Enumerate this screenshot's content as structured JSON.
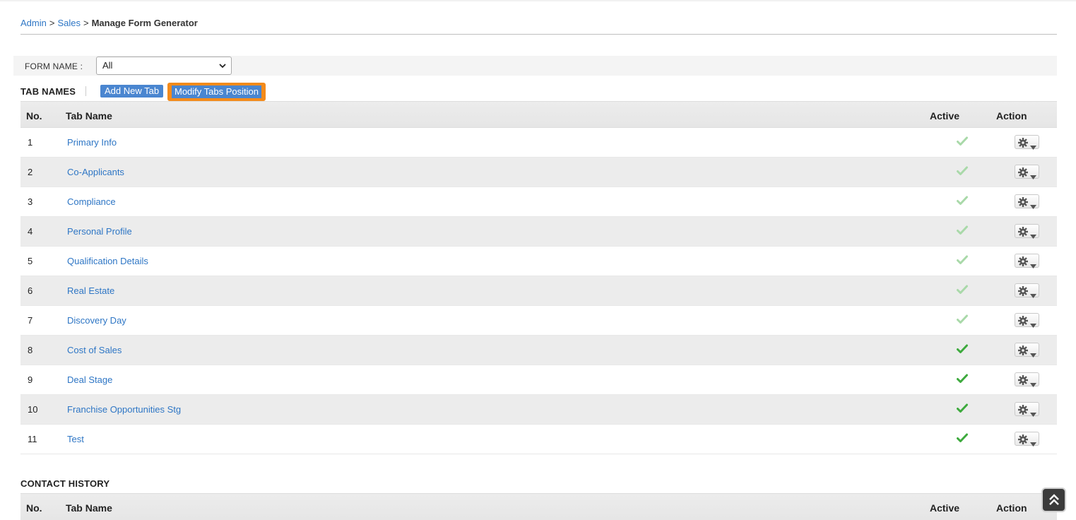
{
  "breadcrumb": {
    "items": [
      "Admin",
      "Sales"
    ],
    "separator": ">",
    "current": "Manage Form Generator"
  },
  "filter": {
    "label": "FORM NAME :",
    "selected": "All"
  },
  "tab_names": {
    "title": "TAB NAMES",
    "add_button": "Add New Tab",
    "modify_button": "Modify Tabs Position",
    "columns": [
      "No.",
      "Tab Name",
      "Active",
      "Action"
    ],
    "rows": [
      {
        "no": "1",
        "name": "Primary Info",
        "active": "faded"
      },
      {
        "no": "2",
        "name": "Co-Applicants",
        "active": "faded"
      },
      {
        "no": "3",
        "name": "Compliance",
        "active": "faded"
      },
      {
        "no": "4",
        "name": "Personal Profile",
        "active": "faded"
      },
      {
        "no": "5",
        "name": "Qualification Details",
        "active": "faded"
      },
      {
        "no": "6",
        "name": "Real Estate",
        "active": "faded"
      },
      {
        "no": "7",
        "name": "Discovery Day",
        "active": "faded"
      },
      {
        "no": "8",
        "name": "Cost of Sales",
        "active": "solid"
      },
      {
        "no": "9",
        "name": "Deal Stage",
        "active": "solid"
      },
      {
        "no": "10",
        "name": "Franchise Opportunities Stg",
        "active": "solid"
      },
      {
        "no": "11",
        "name": "Test",
        "active": "solid"
      }
    ]
  },
  "contact_history": {
    "title": "CONTACT HISTORY",
    "columns": [
      "No.",
      "Tab Name",
      "Active",
      "Action"
    ]
  },
  "colors": {
    "link": "#2e76c5",
    "button": "#4a86d0",
    "highlight": "#f48b1b",
    "check_solid": "#3daa3d",
    "check_faded": "#a9d9a9"
  },
  "icons": {
    "active": "checkmark-icon",
    "action": "gear-icon",
    "dropdown": "caret-down-icon",
    "scroll": "double-chevron-up-icon"
  }
}
